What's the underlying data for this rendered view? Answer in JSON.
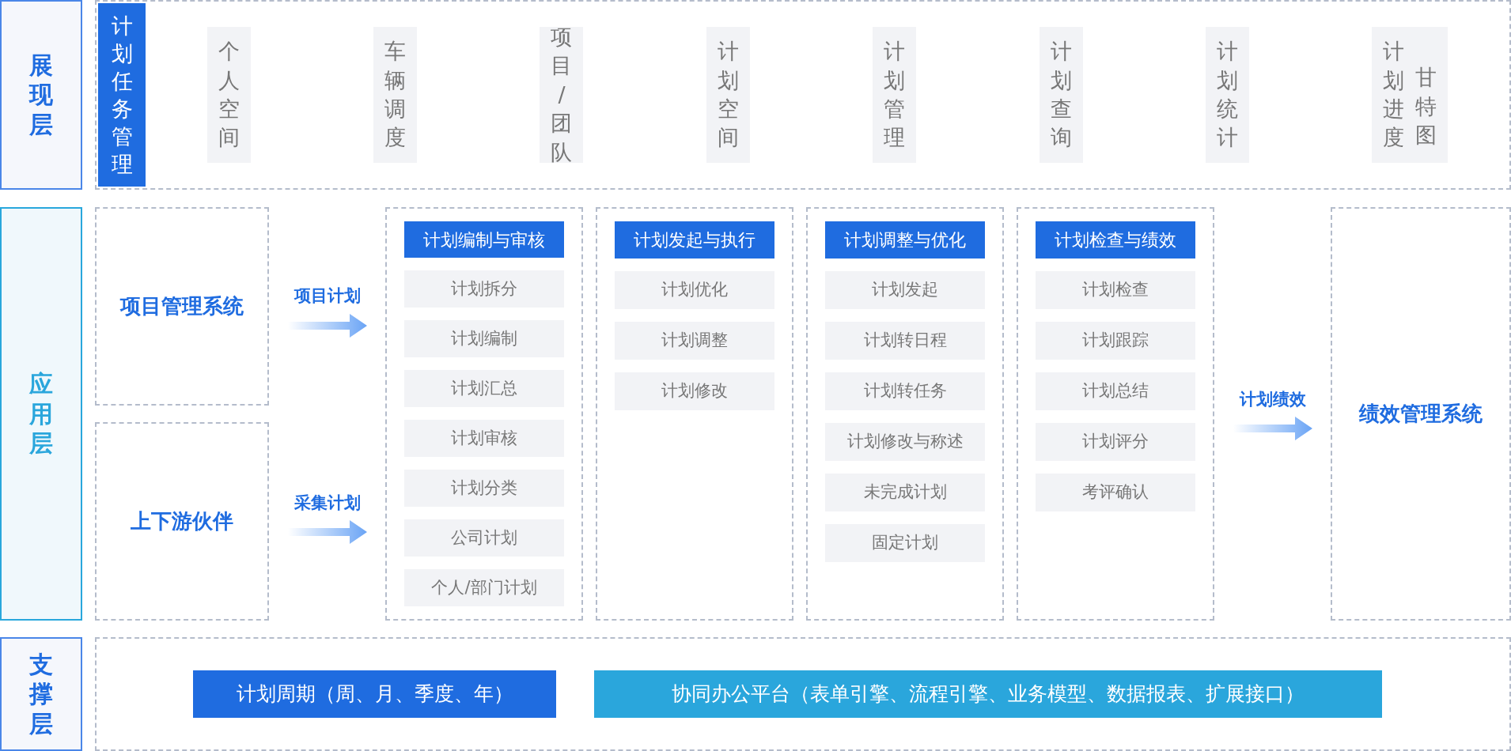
{
  "presentation": {
    "layer_label": "展现层",
    "title": "计划任务管理",
    "items": [
      {
        "columns": [
          "个人空间"
        ]
      },
      {
        "columns": [
          "车辆调度"
        ]
      },
      {
        "columns": [
          "项目/团队"
        ]
      },
      {
        "columns": [
          "计划空间"
        ]
      },
      {
        "columns": [
          "计划管理"
        ]
      },
      {
        "columns": [
          "计划查询"
        ]
      },
      {
        "columns": [
          "计划统计"
        ]
      },
      {
        "columns": [
          "计划进度",
          "甘特图"
        ]
      }
    ]
  },
  "application": {
    "layer_label": "应用层",
    "sources": [
      {
        "name": "项目管理系统",
        "flow_label": "项目计划"
      },
      {
        "name": "上下游伙伴",
        "flow_label": "采集计划"
      }
    ],
    "modules": [
      {
        "title": "计划编制与审核",
        "items": [
          "计划拆分",
          "计划编制",
          "计划汇总",
          "计划审核",
          "计划分类",
          "公司计划",
          "个人/部门计划"
        ]
      },
      {
        "title": "计划发起与执行",
        "items": [
          "计划优化",
          "计划调整",
          "计划修改"
        ]
      },
      {
        "title": "计划调整与优化",
        "items": [
          "计划发起",
          "计划转日程",
          "计划转任务",
          "计划修改与称述",
          "未完成计划",
          "固定计划"
        ]
      },
      {
        "title": "计划检查与绩效",
        "items": [
          "计划检查",
          "计划跟踪",
          "计划总结",
          "计划评分",
          "考评确认"
        ]
      }
    ],
    "output": {
      "flow_label": "计划绩效",
      "target": "绩效管理系统"
    }
  },
  "support": {
    "layer_label": "支撑层",
    "bars": [
      {
        "text": "计划周期（周、月、季度、年）",
        "color": "#1f6ce0"
      },
      {
        "text": "协同办公平台（表单引擎、流程引擎、业务模型、数据报表、扩展接口）",
        "color": "#2aa6dc"
      }
    ]
  }
}
